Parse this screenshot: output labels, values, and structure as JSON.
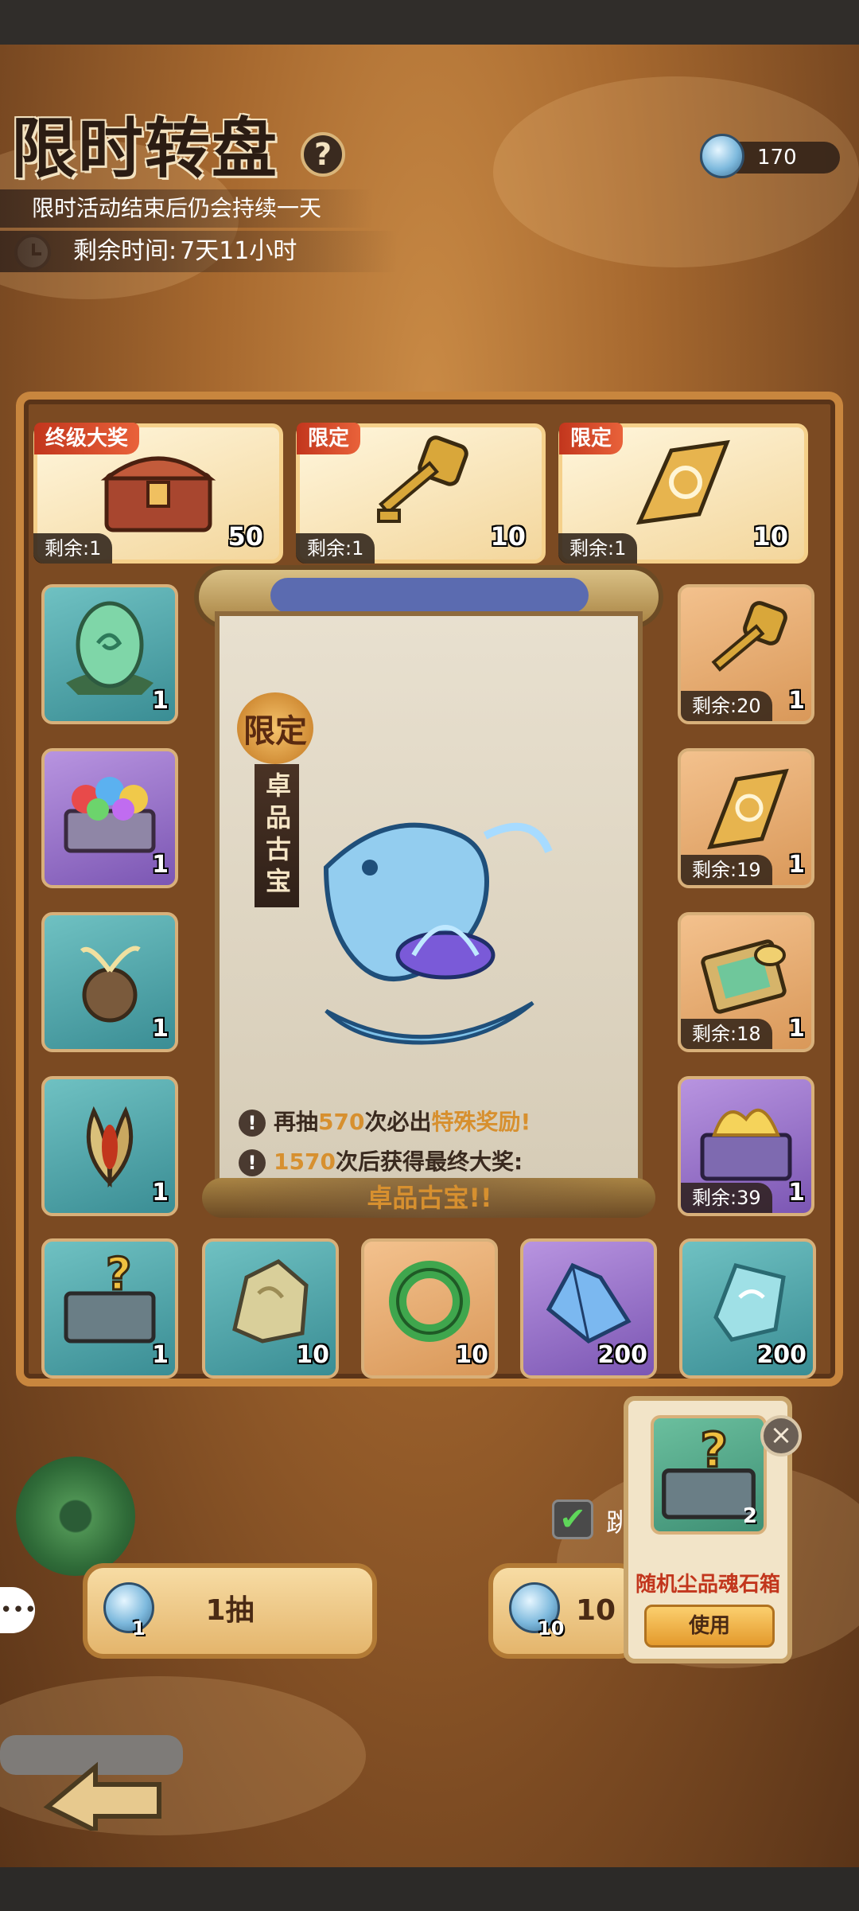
{
  "header": {
    "title": "限时转盘",
    "help_icon": "question-icon",
    "subtitle": "限时活动结束后仍会持续一天",
    "timer_label": "剩余时间:",
    "timer_value": "7天11小时"
  },
  "currency": {
    "icon": "blue-coin-icon",
    "amount": "170"
  },
  "top_prizes": [
    {
      "tag": "终级大奖",
      "item": "treasure-chest",
      "count": "50",
      "remain": "剩余:1"
    },
    {
      "tag": "限定",
      "item": "golden-key",
      "count": "10",
      "remain": "剩余:1"
    },
    {
      "tag": "限定",
      "item": "golden-scroll",
      "count": "10",
      "remain": "剩余:1"
    }
  ],
  "left_items": [
    {
      "item": "green-egg",
      "count": "1",
      "color": "teal"
    },
    {
      "item": "gem-chest",
      "count": "1",
      "color": "purple"
    },
    {
      "item": "sprout-seed",
      "count": "1",
      "color": "teal"
    },
    {
      "item": "bud-seed",
      "count": "1",
      "color": "teal"
    }
  ],
  "right_items": [
    {
      "item": "golden-key",
      "count": "1",
      "remain": "剩余:20",
      "color": "orange"
    },
    {
      "item": "golden-scroll",
      "count": "1",
      "remain": "剩余:19",
      "color": "orange"
    },
    {
      "item": "jade-spoon",
      "count": "1",
      "remain": "剩余:18",
      "color": "orange"
    },
    {
      "item": "flame-chest",
      "count": "1",
      "remain": "剩余:39",
      "color": "purple"
    }
  ],
  "bottom_items": [
    {
      "item": "mystery-chest",
      "count": "1",
      "color": "teal"
    },
    {
      "item": "ore-stone",
      "count": "10",
      "color": "teal"
    },
    {
      "item": "jade-ring",
      "count": "10",
      "color": "orange"
    },
    {
      "item": "blue-crystal",
      "count": "200",
      "color": "purple"
    },
    {
      "item": "spirit-stone",
      "count": "200",
      "color": "teal"
    }
  ],
  "featured": {
    "badge": "限定",
    "name": "卓品古宝",
    "line1_pre": "再抽",
    "line1_num": "570",
    "line1_mid": "次必出",
    "line1_reward": "特殊奖励!",
    "line2_num": "1570",
    "line2_text": "次后获得最终大奖:",
    "final_prize": "卓品古宝!!"
  },
  "pull_buttons": [
    {
      "label": "1抽",
      "cost": "1"
    },
    {
      "label": "10",
      "cost": "10"
    }
  ],
  "skip_checkbox": {
    "checked": true,
    "label": "跳"
  },
  "popup": {
    "item_name": "随机尘品魂石箱",
    "count": "2",
    "use_label": "使用",
    "close_icon": "close-icon"
  },
  "colors": {
    "accent_red": "#c2361d",
    "gold": "#d7902f",
    "panel_brown": "#7b4a22"
  }
}
